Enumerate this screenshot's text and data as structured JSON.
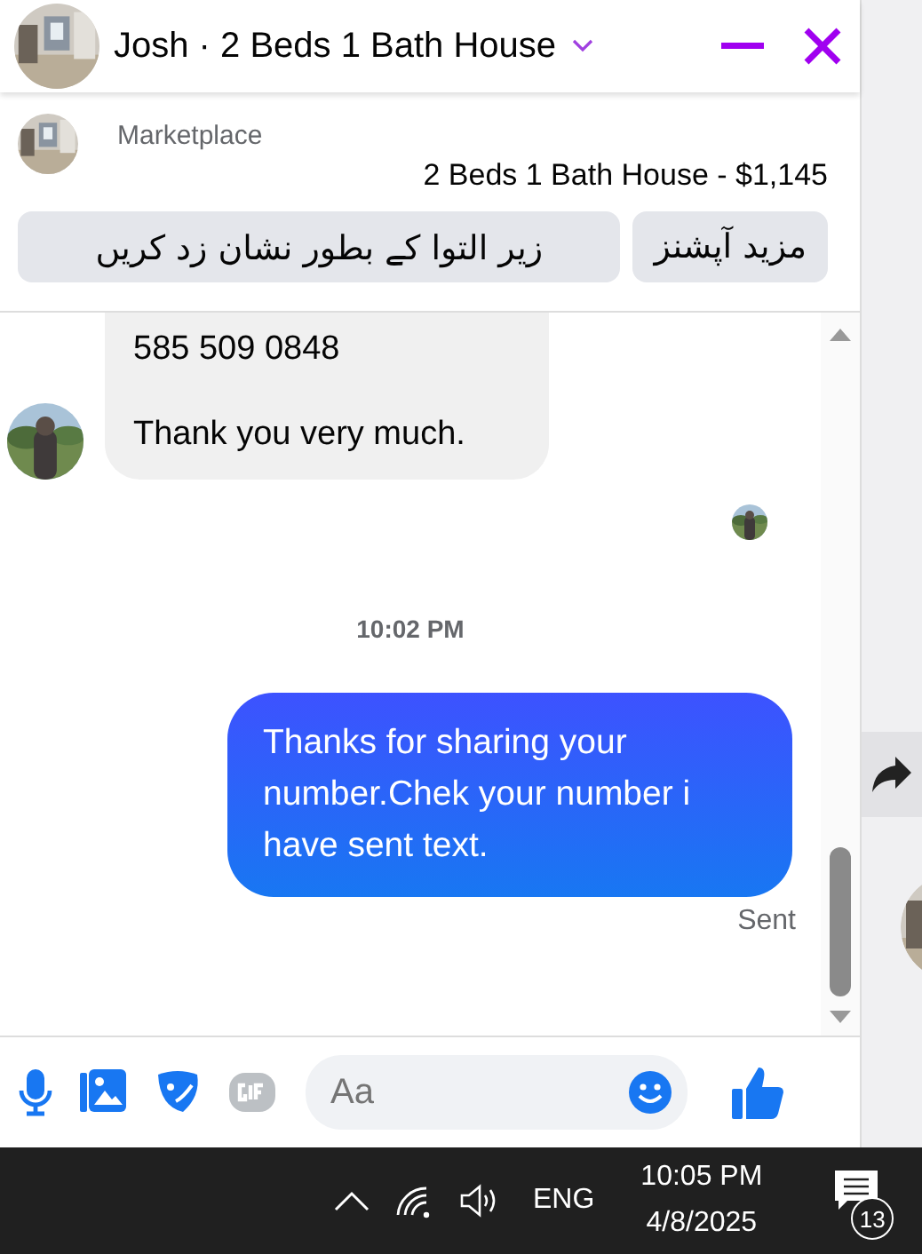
{
  "chat_header": {
    "title": "Josh · 2 Beds 1 Bath House"
  },
  "listing": {
    "source": "Marketplace",
    "title": "2 Beds 1 Bath House - $1,145",
    "buttons": [
      "مزید آپشنز",
      "زیر التوا کے بطور نشان زد کریں"
    ]
  },
  "messages": [
    {
      "kind": "received",
      "lines": [
        "585 509 0848",
        "Thank you very much."
      ]
    },
    {
      "kind": "receipt"
    },
    {
      "kind": "time",
      "text": "10:02 PM"
    },
    {
      "kind": "sent",
      "lines": [
        "Thanks for sharing your number.Chek your number i have sent text."
      ],
      "status": "Sent"
    }
  ],
  "composer": {
    "placeholder": "Aa"
  },
  "taskbar": {
    "language": "ENG",
    "time": "10:05 PM",
    "date": "4/8/2025",
    "notifications": "13"
  }
}
